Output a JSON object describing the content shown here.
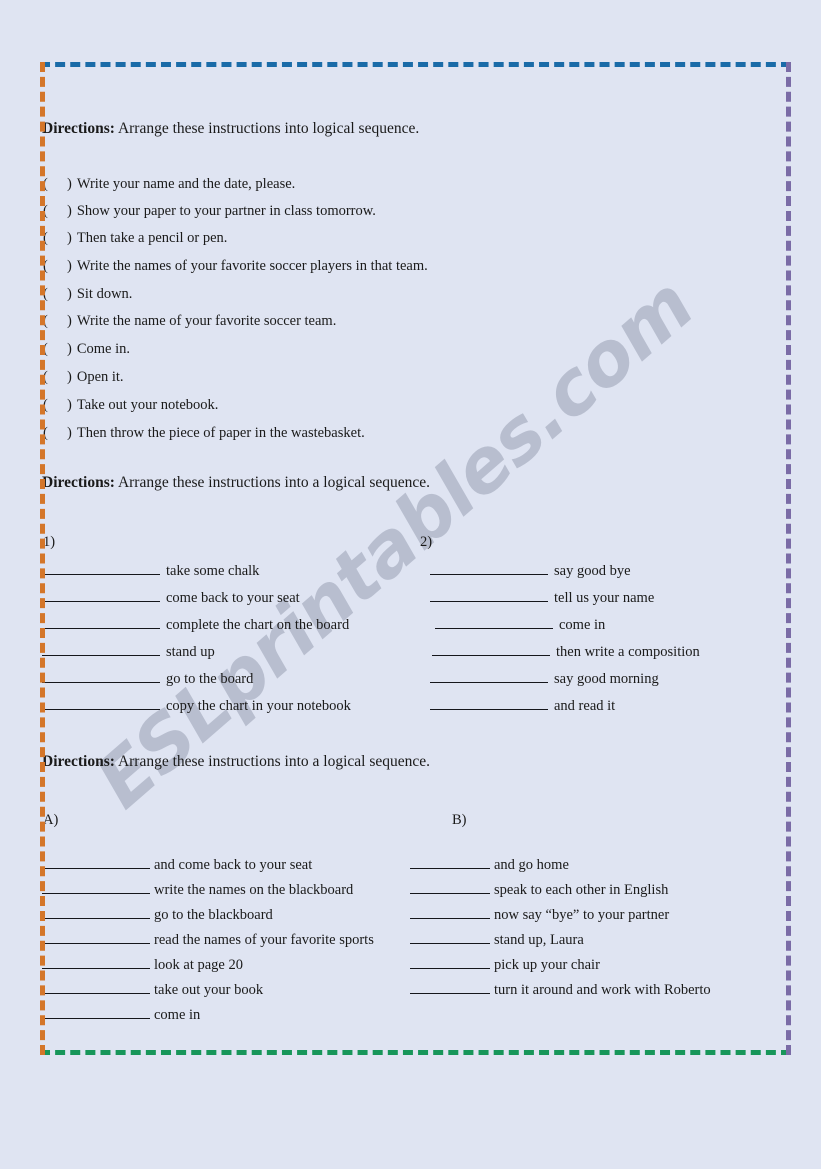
{
  "page": {
    "background_color": "#dfe4f2",
    "watermark": "ESLprintables.com"
  },
  "frame": {
    "top_color": "#1a6ba8",
    "bottom_color": "#17965a",
    "left_color": "#d4762a",
    "right_color": "#7a6ba6"
  },
  "sections": {
    "one": {
      "directions_label": "Directions:",
      "directions_text": "Arrange these instructions into logical sequence.",
      "items": [
        "Write your name and the date, please.",
        "Show your paper to your partner in class tomorrow.",
        "Then take a pencil or pen.",
        "Write the names of your favorite soccer players in that team.",
        "Sit down.",
        "Write the name of your favorite soccer team.",
        "Come in.",
        "Open it.",
        "Take out your notebook.",
        "Then throw the piece of paper in the wastebasket."
      ],
      "paren_open": "(",
      "paren_close": ")"
    },
    "two": {
      "directions_label": "Directions:",
      "directions_text": "Arrange these instructions into a logical sequence.",
      "col1_label": "1)",
      "col2_label": "2)",
      "col1_items": [
        "take some chalk",
        "come back to your seat",
        "complete the chart on the board",
        "stand up",
        "go to the board",
        "copy the chart in your notebook"
      ],
      "col2_items": [
        "say good bye",
        "tell us your name",
        "come in",
        "then write a composition",
        "say good morning",
        "and read it"
      ]
    },
    "three": {
      "directions_label": "Directions:",
      "directions_text": "Arrange these instructions into a logical sequence.",
      "colA_label": "A)",
      "colB_label": "B)",
      "colA_items": [
        "and come back to your seat",
        "write the names on the blackboard",
        "go to the blackboard",
        "read the names of your favorite sports",
        "look at page 20",
        "take out your book",
        "come in"
      ],
      "colB_items": [
        "and go home",
        "speak to each other in English",
        "now say “bye” to your partner",
        "stand up, Laura",
        "pick up your chair",
        "turn it around and work with Roberto"
      ]
    }
  }
}
